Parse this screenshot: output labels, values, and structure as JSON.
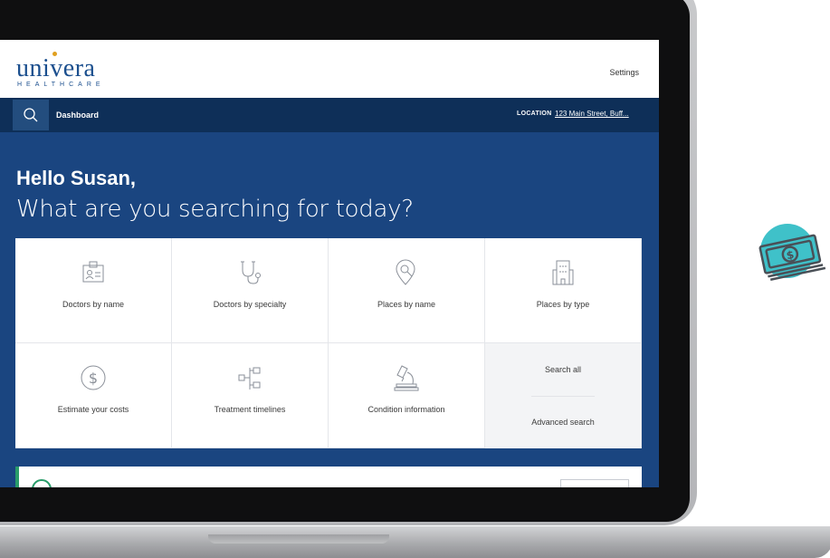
{
  "app": {
    "logo_word": "univera",
    "logo_sub": "HEALTHCARE",
    "settings_label": "Settings"
  },
  "nav": {
    "dashboard_label": "Dashboard",
    "location_label": "LOCATION",
    "location_value": "123 Main Street, Buff..."
  },
  "hero": {
    "greeting": "Hello Susan,",
    "question": "What are you searching for today?"
  },
  "tiles": [
    {
      "label": "Doctors by name",
      "icon": "id-card-icon"
    },
    {
      "label": "Doctors by specialty",
      "icon": "stethoscope-icon"
    },
    {
      "label": "Places by name",
      "icon": "map-pin-search-icon"
    },
    {
      "label": "Places by type",
      "icon": "building-icon"
    },
    {
      "label": "Estimate your costs",
      "icon": "dollar-circle-icon"
    },
    {
      "label": "Treatment timelines",
      "icon": "flow-chart-icon"
    },
    {
      "label": "Condition information",
      "icon": "microscope-icon"
    }
  ],
  "quick_actions": {
    "search_all": "Search all",
    "advanced_search": "Advanced search"
  },
  "colors": {
    "brand_blue": "#1a4580",
    "nav_blue": "#0e2f58",
    "accent_green": "#2a9c6a",
    "badge_teal": "#3fc1c9"
  },
  "badge": {
    "icon": "money-bill-icon"
  }
}
